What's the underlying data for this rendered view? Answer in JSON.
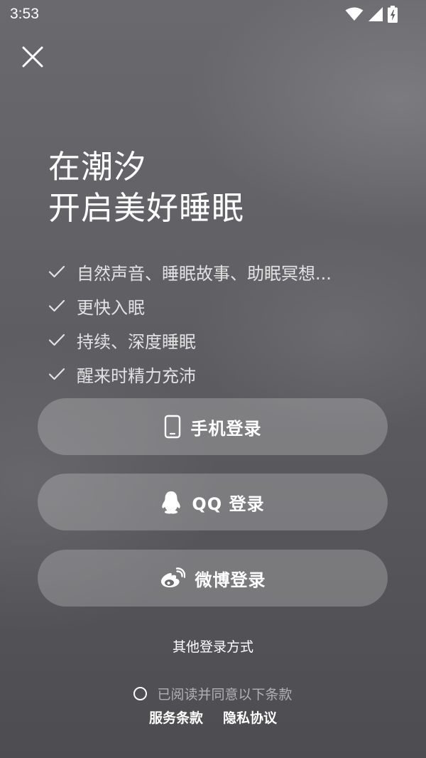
{
  "status_bar": {
    "time": "3:53"
  },
  "hero": {
    "line1": "在潮汐",
    "line2": "开启美好睡眠"
  },
  "features": [
    "自然声音、睡眠故事、助眠冥想...",
    "更快入眠",
    "持续、深度睡眠",
    "醒来时精力充沛"
  ],
  "buttons": {
    "phone": {
      "label": "手机登录",
      "icon": "phone-icon"
    },
    "qq": {
      "label": "QQ 登录",
      "icon": "qq-icon"
    },
    "weibo": {
      "label": "微博登录",
      "icon": "weibo-icon"
    }
  },
  "other_login": "其他登录方式",
  "agreement": {
    "text": "已阅读并同意以下条款",
    "terms": "服务条款",
    "privacy": "隐私协议"
  },
  "colors": {
    "button_bg": "rgba(255,255,255,0.22)",
    "text": "#ffffff"
  }
}
